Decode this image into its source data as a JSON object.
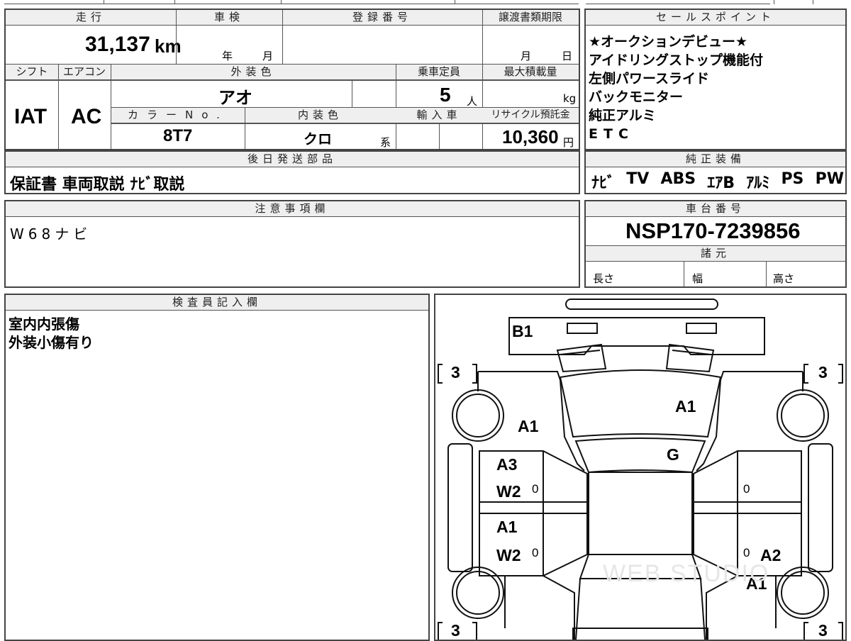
{
  "basic": {
    "mileage_label": "走行",
    "mileage_value": "31,137",
    "mileage_unit": "km",
    "inspection_label": "車検",
    "inspection_year": "年",
    "inspection_month": "月",
    "registration_label": "登録番号",
    "transfer_label": "譲渡書類期限",
    "transfer_month": "月",
    "transfer_day": "日",
    "shift_label": "シフト",
    "shift_value": "IAT",
    "ac_label": "エアコン",
    "ac_value": "AC",
    "exterior_label": "外装色",
    "exterior_value": "アオ",
    "capacity_label": "乗車定員",
    "capacity_value": "5",
    "capacity_unit": "人",
    "maxload_label": "最大積載量",
    "maxload_unit": "kg",
    "color_no_label": "カラーNo.",
    "color_no_value": "8T7",
    "interior_label": "内装色",
    "interior_value": "クロ",
    "interior_unit": "系",
    "import_label": "輸入車",
    "recycle_label": "リサイクル預託金",
    "recycle_value": "10,360",
    "recycle_unit": "円"
  },
  "later_parts": {
    "label": "後日発送部品",
    "value": "保証書 車両取説 ﾅﾋﾞ取説"
  },
  "sales_points": {
    "label": "セールスポイント",
    "items": [
      "★オークションデビュー★",
      "アイドリングストップ機能付",
      "左側パワースライド",
      "バックモニター",
      "純正アルミ",
      "ETC"
    ]
  },
  "equipment": {
    "label": "純正装備",
    "items": [
      "ﾅﾋﾞ",
      "TV",
      "ABS",
      "ｴｱB",
      "ｱﾙﾐ",
      "PS",
      "PW"
    ]
  },
  "notes": {
    "label": "注意事項欄",
    "value": "W68ナビ"
  },
  "chassis": {
    "label": "車台番号",
    "value": "NSP170-7239856",
    "specs_label": "諸元",
    "length_label": "長さ",
    "width_label": "幅",
    "height_label": "高さ"
  },
  "inspector": {
    "label": "検査員記入欄",
    "lines": [
      "室内内張傷",
      "外装小傷有り"
    ]
  },
  "diagram": {
    "corner_tl": "3",
    "corner_tr": "3",
    "corner_bl": "3",
    "corner_br": "3",
    "marks": {
      "b1": "B1",
      "a1_hood": "A1",
      "a1_left_front": "A1",
      "g_windshield": "G",
      "a3_left_front_door": "A3",
      "w2_left_front_door": "W2",
      "a1_left_rear_door": "A1",
      "w2_left_rear_door": "W2",
      "a2_right_rear": "A2",
      "a1_right_rear": "A1"
    },
    "zeros": [
      "0",
      "0",
      "0",
      "0"
    ],
    "watermark": "WEB STUDIO"
  }
}
